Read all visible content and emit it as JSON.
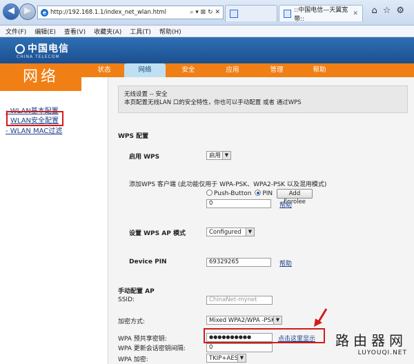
{
  "browser": {
    "url": "http://192.168.1.1/index_net_wlan.html",
    "tabs": [
      {
        "label": ""
      },
      {
        "label": "::中国电信—天翼宽带::"
      }
    ],
    "menu": [
      "文件(F)",
      "编辑(E)",
      "查看(V)",
      "收藏夹(A)",
      "工具(T)",
      "帮助(H)"
    ]
  },
  "brand": {
    "logo": "中国电信",
    "logo_sub": "CHINA TELECOM"
  },
  "page": {
    "section_title": "网络",
    "nav": [
      "状态",
      "网络",
      "安全",
      "应用",
      "管理",
      "帮助"
    ],
    "nav_active_index": 1
  },
  "sidebar": {
    "items": [
      "- WLAN基本配置",
      "WLAN安全配置",
      "- WLAN MAC过滤"
    ],
    "selected_index": 1
  },
  "content": {
    "info_title": "无线设置 -- 安全",
    "info_desc": "本页配置无线LAN 口的安全特性，你也可以手动配置 或者 通过WPS",
    "wps_section": "WPS 配置",
    "enable_wps_label": "启用 WPS",
    "enable_wps_value": "启用",
    "add_client_label": "添加WPS 客户端 (此功能仅用于 WPA-PSK、WPA2-PSK 以及混用模式)",
    "radio_push": "Push-Button",
    "radio_pin": "PIN",
    "add_enrolee": "Add Enrolee",
    "pin_input": "0",
    "help": "帮助",
    "wps_ap_mode_label": "设置 WPS AP 模式",
    "wps_ap_mode_value": "Configured",
    "device_pin_label": "Device PIN",
    "device_pin_value": "69329265",
    "manual_section": "手动配置 AP",
    "ssid_label": "SSID:",
    "ssid_value": "ChinaNet-mynet",
    "encryption_label": "加密方式:",
    "encryption_value": "Mixed WPA2/WPA -PSK",
    "wpa_psk_label": "WPA 预共享密钥:",
    "wpa_psk_value": "●●●●●●●●●●",
    "show_password": "点击这里显示",
    "wpa_rekey_label": "WPA 更新会话密钥间隔:",
    "wpa_rekey_value": "0",
    "wpa_cipher_label": "WPA 加密:",
    "wpa_cipher_value": "TKIP+AES"
  },
  "watermark": {
    "cn": "路由器网",
    "url": "LUYOUQI.NET"
  },
  "colors": {
    "orange": "#f07f15",
    "brand_blue": "#1b4f8f",
    "highlight_red": "#d21a1a",
    "link": "#1c3f86"
  }
}
